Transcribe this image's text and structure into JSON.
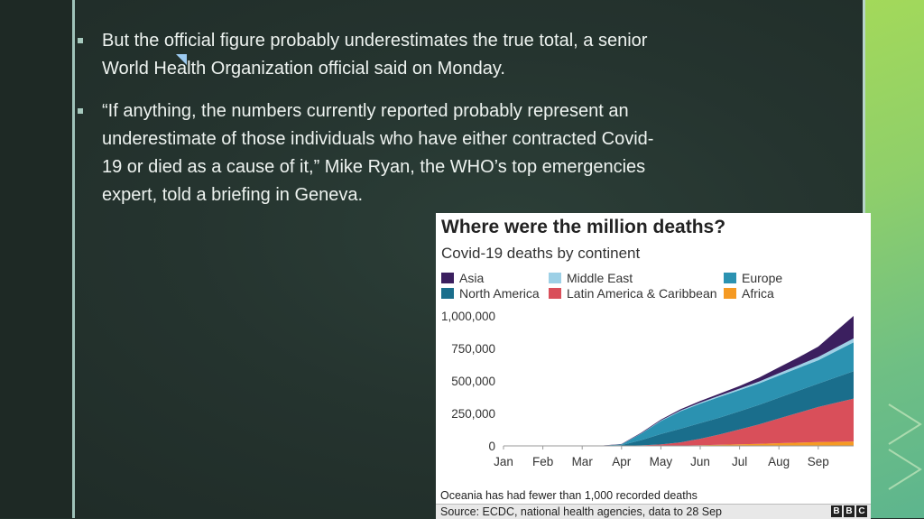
{
  "slide": {
    "bullets": [
      {
        "text": "But the official figure probably underestimates the true total, a senior World Health Organization official said on Monday."
      },
      {
        "text": "“If anything, the numbers currently reported probably represent an underestimate of those individuals who have either contracted Covid-19 or died as a cause of it,” Mike Ryan, the WHO’s top emergencies expert, told a briefing in Geneva."
      }
    ]
  },
  "chart_card": {
    "title": "Where were the million deaths?",
    "subtitle": "Covid-19 deaths by continent",
    "note": "Oceania has had fewer than 1,000 recorded deaths",
    "source": "Source: ECDC, national health agencies, data to 28 Sep",
    "logo_letters": [
      "B",
      "B",
      "C"
    ]
  },
  "chart_data": {
    "type": "area",
    "stacked": true,
    "title": "Where were the million deaths?",
    "subtitle": "Covid-19 deaths by continent",
    "categories": [
      "Jan",
      "Feb",
      "Mar",
      "Apr",
      "May",
      "Jun",
      "Jul",
      "Aug",
      "Sep"
    ],
    "y_ticks": [
      "0",
      "250,000",
      "500,000",
      "750,000",
      "1,000,000"
    ],
    "y_tick_values": [
      0,
      250000,
      500000,
      750000,
      1000000
    ],
    "ylim": [
      0,
      1000000
    ],
    "x_points": [
      0,
      1,
      2,
      2.5,
      3,
      3.5,
      4,
      4.5,
      5,
      5.5,
      6,
      6.5,
      7,
      7.5,
      8,
      8.9
    ],
    "series": [
      {
        "name": "Africa",
        "color": "#f59a23",
        "values": [
          0,
          0,
          0,
          0,
          200,
          500,
          1000,
          2000,
          5000,
          8000,
          12000,
          16000,
          21000,
          25000,
          29000,
          34000
        ]
      },
      {
        "name": "Latin America & Caribbean",
        "color": "#d94f5a",
        "values": [
          0,
          0,
          0,
          0,
          1000,
          4000,
          10000,
          25000,
          50000,
          80000,
          115000,
          150000,
          190000,
          230000,
          270000,
          330000
        ]
      },
      {
        "name": "North America",
        "color": "#1a6e8c",
        "values": [
          0,
          0,
          0,
          1000,
          5000,
          40000,
          80000,
          105000,
          120000,
          130000,
          140000,
          150000,
          160000,
          170000,
          180000,
          210000
        ]
      },
      {
        "name": "Europe",
        "color": "#2b92b1",
        "values": [
          0,
          0,
          0,
          1000,
          5000,
          50000,
          100000,
          135000,
          150000,
          160000,
          162000,
          165000,
          170000,
          175000,
          180000,
          223000
        ]
      },
      {
        "name": "Middle East",
        "color": "#9dd0e6",
        "values": [
          0,
          0,
          0,
          0,
          500,
          2000,
          4000,
          6000,
          8000,
          10000,
          12000,
          15000,
          18000,
          21000,
          25000,
          30000
        ]
      },
      {
        "name": "Asia",
        "color": "#3b1f5f",
        "values": [
          0,
          0,
          0,
          1000,
          3000,
          5000,
          7000,
          9000,
          12000,
          15000,
          20000,
          30000,
          45000,
          60000,
          80000,
          173000
        ]
      }
    ],
    "legend": [
      {
        "name": "Asia",
        "color": "#3b1f5f"
      },
      {
        "name": "Middle East",
        "color": "#9dd0e6"
      },
      {
        "name": "Europe",
        "color": "#2b92b1"
      },
      {
        "name": "North America",
        "color": "#1a6e8c"
      },
      {
        "name": "Latin America & Caribbean",
        "color": "#d94f5a"
      },
      {
        "name": "Africa",
        "color": "#f59a23"
      }
    ],
    "legend_position": "top",
    "grid": false
  }
}
